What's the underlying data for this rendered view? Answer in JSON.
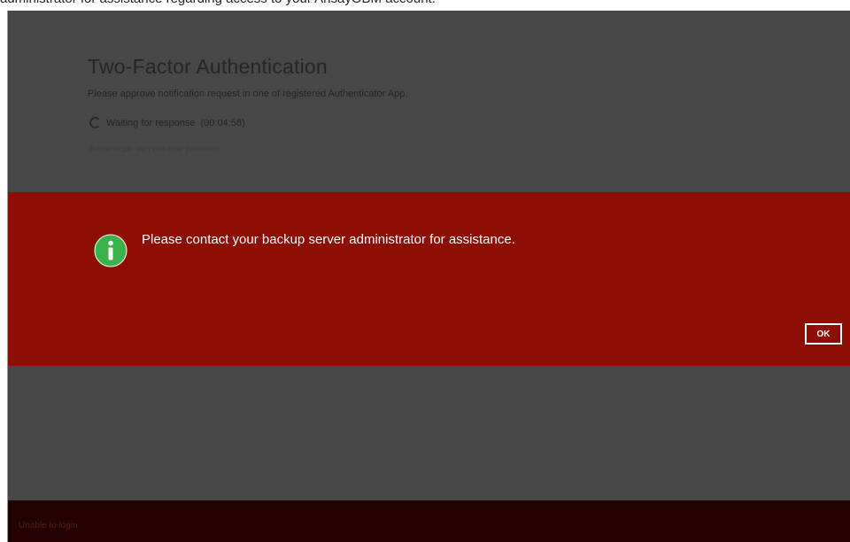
{
  "caption": "administrator for assistance regarding access to your AhsayOBM account.",
  "dialog": {
    "title": "Two-Factor Authentication",
    "description": "Please approve notification request in one of registered Authenticator App.",
    "waiting_text": "Waiting for response",
    "countdown": "(00:04:58)",
    "link_text": "Authenticate with one-time password"
  },
  "alert": {
    "icon": "info-icon",
    "message": "Please contact your backup server administrator for assistance.",
    "ok_label": "OK",
    "background_color": "#8e0e05",
    "icon_color": "#3ab24a"
  },
  "footer": {
    "status_text": "Unable to login"
  }
}
